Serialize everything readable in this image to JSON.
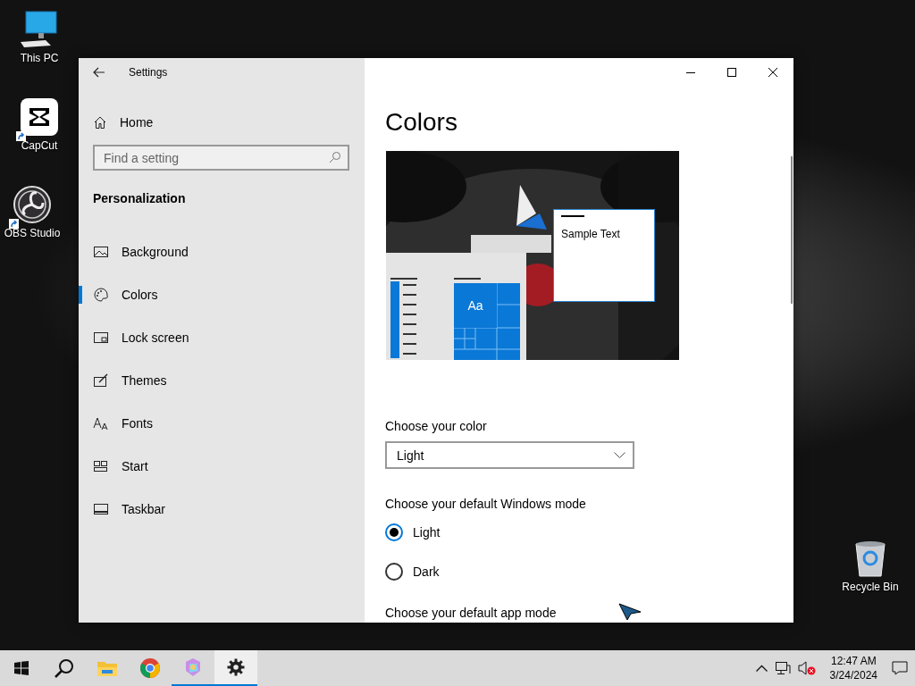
{
  "desktop_icons": [
    {
      "label": "This PC",
      "kind": "pc",
      "shortcut": false
    },
    {
      "label": "CapCut",
      "kind": "capcut",
      "shortcut": true
    },
    {
      "label": "OBS Studio",
      "kind": "obs",
      "shortcut": true
    },
    {
      "label": "Recycle Bin",
      "kind": "bin",
      "shortcut": false
    }
  ],
  "window": {
    "title": "Settings",
    "home": "Home",
    "search": {
      "placeholder": "Find a setting"
    },
    "section": "Personalization",
    "nav": [
      {
        "label": "Background",
        "kind": "picture",
        "selected": false
      },
      {
        "label": "Colors",
        "kind": "palette",
        "selected": true
      },
      {
        "label": "Lock screen",
        "kind": "lock",
        "selected": false
      },
      {
        "label": "Themes",
        "kind": "brush",
        "selected": false
      },
      {
        "label": "Fonts",
        "kind": "fonts",
        "selected": false
      },
      {
        "label": "Start",
        "kind": "start",
        "selected": false
      },
      {
        "label": "Taskbar",
        "kind": "taskbar",
        "selected": false
      }
    ],
    "page_title": "Colors",
    "preview": {
      "sample_text": "Sample Text",
      "tile_text": "Aa"
    },
    "color_label": "Choose your color",
    "color_value": "Light",
    "windows_mode": {
      "label": "Choose your default Windows mode",
      "options": [
        {
          "label": "Light",
          "selected": true
        },
        {
          "label": "Dark",
          "selected": false
        }
      ]
    },
    "app_mode_label": "Choose your default app mode"
  },
  "taskbar": {
    "apps": [
      {
        "kind": "start",
        "running": false,
        "active": false
      },
      {
        "kind": "search",
        "running": false,
        "active": false
      },
      {
        "kind": "explorer",
        "running": false,
        "active": false
      },
      {
        "kind": "chrome",
        "running": false,
        "active": false
      },
      {
        "kind": "photos",
        "running": true,
        "active": false
      },
      {
        "kind": "settings",
        "running": true,
        "active": true
      }
    ],
    "time": "12:47 AM",
    "date": "3/24/2024"
  }
}
